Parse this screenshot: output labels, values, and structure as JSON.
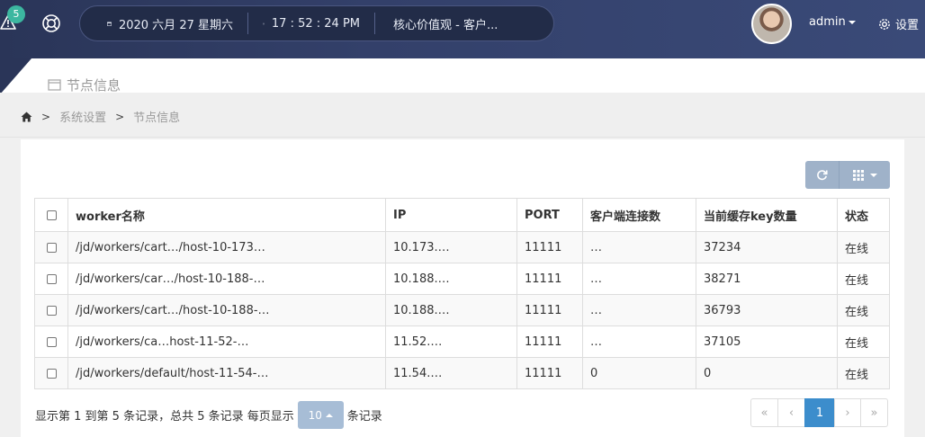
{
  "topbar": {
    "alert_count": "5",
    "date": "2020 六月 27 星期六",
    "time": "17 : 52 : 24 PM",
    "value_text": "核心价值观  -  客户...",
    "user": "admin",
    "settings_label": "设置"
  },
  "page": {
    "title": "节点信息"
  },
  "breadcrumb": {
    "items": [
      "系统设置",
      "节点信息"
    ]
  },
  "table": {
    "columns": [
      "worker名称",
      "IP",
      "PORT",
      "客户端连接数",
      "当前缓存key数量",
      "状态"
    ],
    "rows": [
      {
        "worker": "/jd/workers/cart…/host-10-173…",
        "ip": "10.173.…",
        "port": "11111",
        "connections": "…",
        "keys": "37234",
        "status": "在线"
      },
      {
        "worker": "/jd/workers/car…/host-10-188-…",
        "ip": "10.188.…",
        "port": "11111",
        "connections": "…",
        "keys": "38271",
        "status": "在线"
      },
      {
        "worker": "/jd/workers/cart…/host-10-188-…",
        "ip": "10.188.…",
        "port": "11111",
        "connections": "…",
        "keys": "36793",
        "status": "在线"
      },
      {
        "worker": "/jd/workers/ca…host-11-52-…",
        "ip": "11.52.…",
        "port": "11111",
        "connections": "…",
        "keys": "37105",
        "status": "在线"
      },
      {
        "worker": "/jd/workers/default/host-11-54-…",
        "ip": "11.54.…",
        "port": "11111",
        "connections": "0",
        "keys": "0",
        "status": "在线"
      }
    ]
  },
  "footer": {
    "summary": "显示第 1 到第 5 条记录，总共 5 条记录 每页显示",
    "page_size": "10",
    "suffix": "条记录"
  },
  "pager": {
    "first": "«",
    "prev": "‹",
    "current": "1",
    "next": "›",
    "last": "»"
  }
}
